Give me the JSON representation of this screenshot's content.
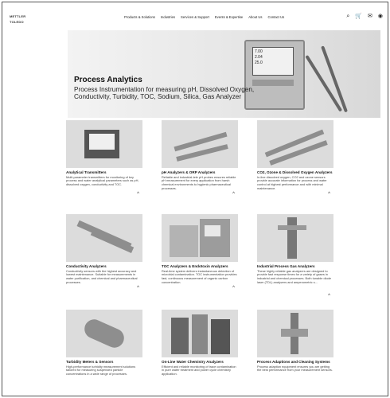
{
  "nav": {
    "logo_text": "METTLER TOLEDO",
    "menu": [
      "Products & Solutions",
      "Industries",
      "Services & Support",
      "Events & Expertise",
      "About Us",
      "Contact Us"
    ],
    "icons": [
      "search-icon",
      "cart-icon",
      "mail-icon",
      "user-icon"
    ]
  },
  "hero": {
    "title": "Process Analytics",
    "subtitle": "Process Instrumentation for measuring pH, Dissolved Oxygen, Conductivity, Turbidity, TOC, Sodium, Silica, Gas Analyzer",
    "device_lines": [
      "7.00",
      "2.04",
      "25.0"
    ]
  },
  "cards": [
    {
      "title": "Analytical Transmitters",
      "desc": "Multi-parameter transmitters for monitoring of key process and water analytical parameters such as pH, dissolved oxygen, conductivity and TOC."
    },
    {
      "title": "pH Analyzers & ORP Analyzers",
      "desc": "Reliable and industrial-tele pH probes ensures reliable pH measurement for every application from harsh chemical environments to hygienic pharmaceutical processes."
    },
    {
      "title": "CO2, Ozone & Dissolved Oxygen Analyzers",
      "desc": "In-line dissolved oxygen, CO2 and ozone sensors provide accurate information for process and water control at highest performance and with minimal maintenance."
    },
    {
      "title": "Conductivity Analyzers",
      "desc": "Conductivity sensors with the highest accuracy and lowest maintenance. Suitable for measurements in water purification, and chemical and pharmaceutical processes."
    },
    {
      "title": "TOC Analyzers & Endotoxin Analyzers",
      "desc": "Real-time system delivers instantaneous detection of microbial contamination. TOC instrumentation provides fast, continuous measurement of organic carbon concentration."
    },
    {
      "title": "Industrial Process Gas Analyzers",
      "desc": "These highly reliable gas analyzers are designed to provide fast response times for a variety of gases in industrial and chemical processes. Both tunable diode laser (TDL) analyzers and amperometric s..."
    },
    {
      "title": "Turbidity Meters & Sensors",
      "desc": "High-performance turbidity measurement solutions tailored for measuring suspended particle concentrations in a wide range of processes."
    },
    {
      "title": "On-Line Water Chemistry Analyzers",
      "desc": "Efficient and reliable monitoring of trace contamination in pure water treatment and power cycle chemistry application."
    },
    {
      "title": "Process Adaptions and Cleaning Systems",
      "desc": "Process adaption equipment ensures you are getting the best performance from your measurement sensors."
    }
  ],
  "caret_symbol": "^"
}
